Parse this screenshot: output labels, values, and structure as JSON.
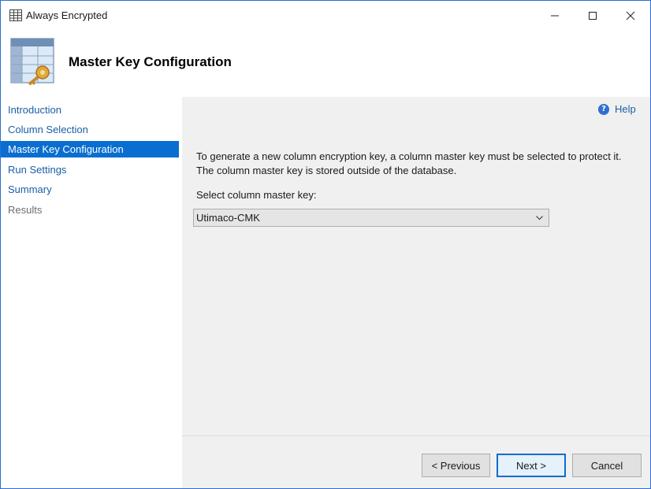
{
  "window": {
    "title": "Always Encrypted"
  },
  "header": {
    "title": "Master Key Configuration"
  },
  "nav": {
    "items": [
      {
        "label": "Introduction"
      },
      {
        "label": "Column Selection"
      },
      {
        "label": "Master Key Configuration"
      },
      {
        "label": "Run Settings"
      },
      {
        "label": "Summary"
      },
      {
        "label": "Results"
      }
    ],
    "active_index": 2
  },
  "content": {
    "help_label": "Help",
    "description": "To generate a new column encryption key, a column master key must be selected to protect it.  The column master key is stored outside of the database.",
    "select_label": "Select column master key:",
    "select_value": "Utimaco-CMK"
  },
  "footer": {
    "previous_label": "< Previous",
    "next_label": "Next >",
    "cancel_label": "Cancel"
  },
  "colors": {
    "accent": "#0a6ed1",
    "link": "#1a5ea8",
    "panel": "#f0f0f0"
  }
}
